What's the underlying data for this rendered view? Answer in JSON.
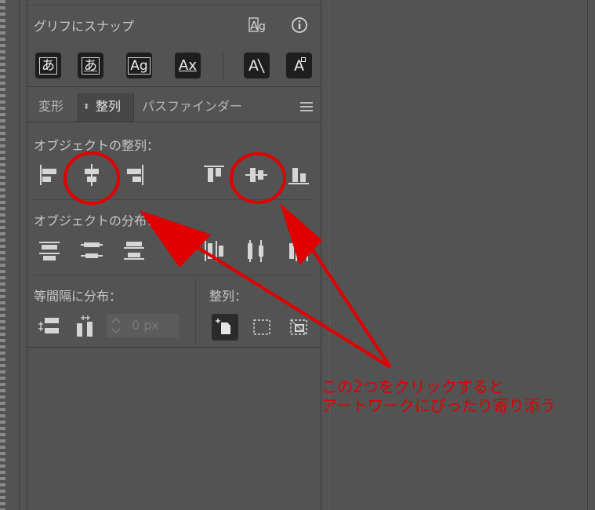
{
  "glyph_snap": {
    "title": "グリフにスナップ",
    "top_icons": [
      "glyph-bounds-icon",
      "info-icon"
    ],
    "buttons": [
      {
        "icon": "hiragana-a-glyph-icon",
        "glyph": "あ"
      },
      {
        "icon": "hiragana-a-strike-glyph-icon",
        "glyph": "あ"
      },
      {
        "icon": "ag-glyph-icon",
        "glyph": "Ag"
      },
      {
        "icon": "ax-glyph-icon",
        "glyph": "Ax"
      },
      {
        "icon": "angle-guide-icon",
        "glyph": "A"
      },
      {
        "icon": "anchor-point-icon",
        "glyph": "A"
      }
    ]
  },
  "tabs": [
    {
      "label": "変形",
      "active": false
    },
    {
      "label": "整列",
      "active": true
    },
    {
      "label": "パスファインダー",
      "active": false
    }
  ],
  "align_objects": {
    "label": "オブジェクトの整列：",
    "icons": [
      "align-left-icon",
      "align-horizontal-center-icon",
      "align-right-icon",
      "align-top-icon",
      "align-vertical-center-icon",
      "align-bottom-icon"
    ]
  },
  "distribute_objects": {
    "label": "オブジェクトの分布：",
    "icons": [
      "distribute-top-icon",
      "distribute-vertical-center-icon",
      "distribute-bottom-icon",
      "distribute-left-icon",
      "distribute-horizontal-center-icon",
      "distribute-right-icon"
    ]
  },
  "distribute_spacing": {
    "label": "等間隔に分布：",
    "value": "0 px",
    "icons": [
      "vertical-distribute-space-icon",
      "horizontal-distribute-space-icon"
    ]
  },
  "align_to": {
    "label": "整列：",
    "icons": [
      "align-to-artboard-icon",
      "align-to-selection-icon",
      "align-to-key-object-icon"
    ],
    "selected_index": 0
  },
  "annotation": {
    "line1": "この2つをクリックすると",
    "line2": "アートワークにぴったり寄り添う",
    "color": "#e00000"
  },
  "colors": {
    "background": "#535353",
    "icon": "#d6d6d6",
    "text": "#c8c8c8",
    "accent_annotation": "#e00000"
  }
}
